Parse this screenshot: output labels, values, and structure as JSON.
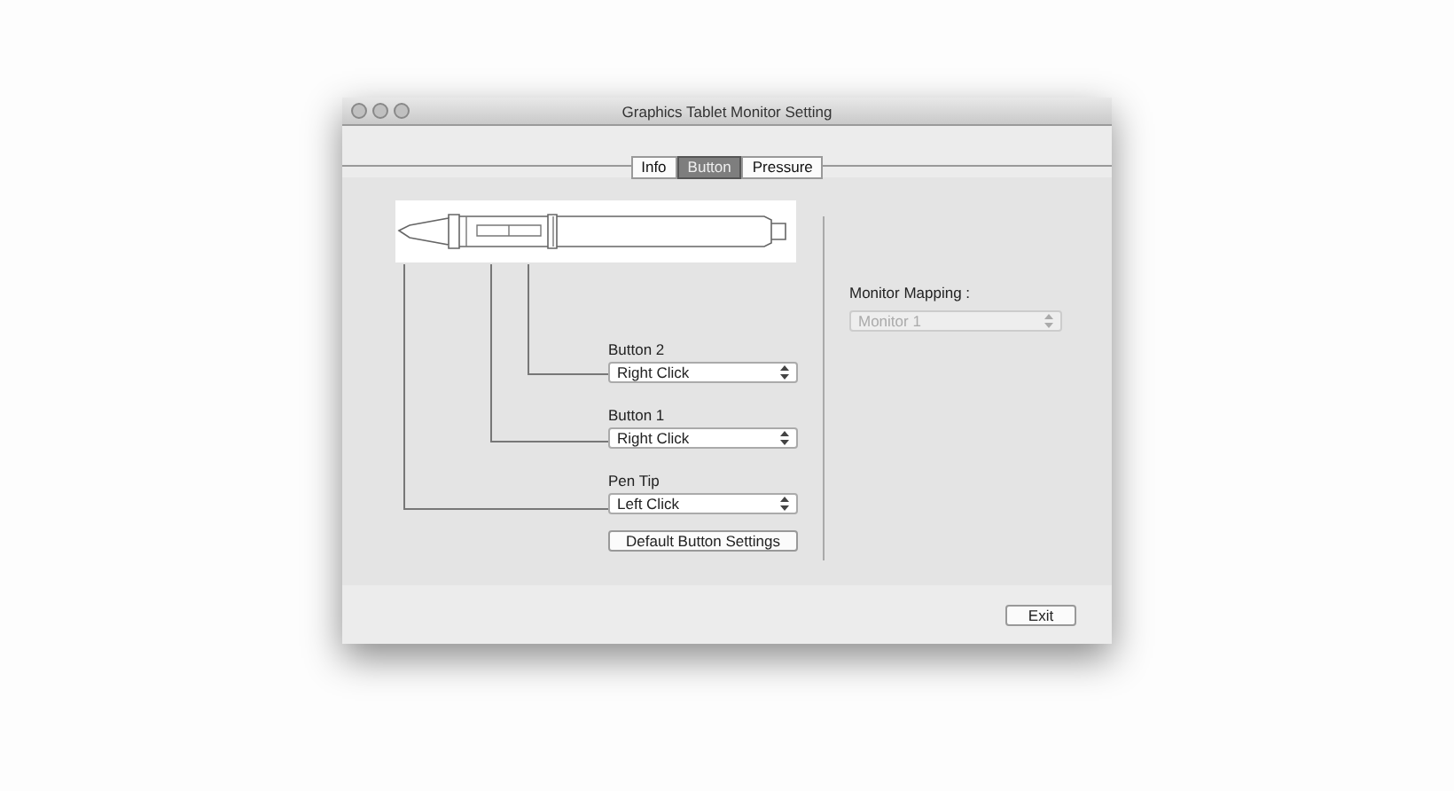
{
  "window": {
    "title": "Graphics Tablet Monitor Setting"
  },
  "tabs": [
    {
      "label": "Info",
      "selected": false
    },
    {
      "label": "Button",
      "selected": true
    },
    {
      "label": "Pressure",
      "selected": false
    }
  ],
  "mappings": [
    {
      "label": "Button 2",
      "value": "Right Click"
    },
    {
      "label": "Button 1",
      "value": "Right Click"
    },
    {
      "label": "Pen Tip",
      "value": "Left Click"
    }
  ],
  "default_button": "Default Button Settings",
  "monitor_mapping": {
    "label": "Monitor Mapping :",
    "value": "Monitor 1",
    "disabled": true
  },
  "exit_button": "Exit"
}
